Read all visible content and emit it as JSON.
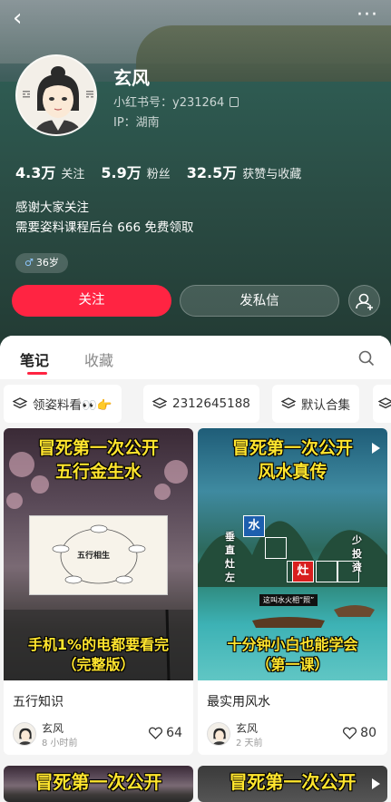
{
  "profile": {
    "name": "玄风",
    "redbook_id": "小红书号：y231264",
    "ip": "IP：湖南",
    "stats": [
      {
        "num": "4.3万",
        "label": "关注"
      },
      {
        "num": "5.9万",
        "label": "粉丝"
      },
      {
        "num": "32.5万",
        "label": "获赞与收藏"
      }
    ],
    "bio_line1": "感谢大家关注",
    "bio_line2": "需要姿料课程后台 666 免费领取",
    "age_gender_icon": "male-icon",
    "age": "36岁"
  },
  "actions": {
    "follow": "关注",
    "message": "发私信"
  },
  "tabs": [
    {
      "label": "笔记",
      "active": true
    },
    {
      "label": "收藏",
      "active": false
    }
  ],
  "collections": [
    {
      "label": "领姿料看👀👉"
    },
    {
      "label": "2312645188"
    },
    {
      "label": "默认合集"
    }
  ],
  "notes": [
    {
      "cover_title_1": "冒死第一次公开",
      "cover_title_2": "五行金生水",
      "cover_bottom_1": "手机1%的电都要看完",
      "cover_bottom_2": "（完整版）",
      "diagram_label": "五行相生",
      "title": "五行知识",
      "author": "玄风",
      "time": "8 小时前",
      "likes": "64"
    },
    {
      "cover_title_1": "冒死第一次公开",
      "cover_title_2": "风水真传",
      "cover_left_text": "垂直灶左",
      "cover_right_text": "少投资",
      "box_water": "水",
      "box_stove": "灶",
      "small_banner": "这叫水火相“照”",
      "cover_bottom_1": "十分钟小白也能学会",
      "cover_bottom_2": "（第一课）",
      "title": "最实用风水",
      "author": "玄风",
      "time": "2 天前",
      "likes": "80"
    },
    {
      "cover_title_1": "冒死第一次公开"
    },
    {
      "cover_title_1": "冒死第一次公开"
    }
  ],
  "colors": {
    "accent": "#ff2442",
    "cover_text": "#ffe52e"
  }
}
